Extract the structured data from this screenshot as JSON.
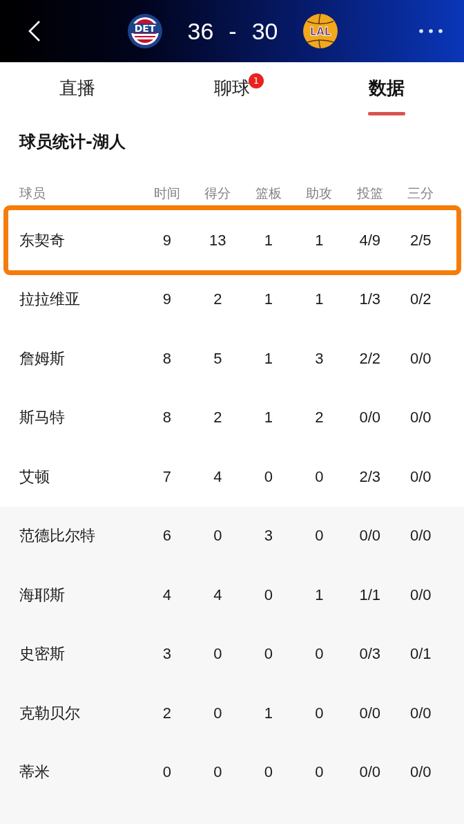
{
  "header": {
    "home_team": {
      "abbr": "DET"
    },
    "home_score": "36",
    "separator": "-",
    "away_score": "30",
    "away_team": {
      "abbr": "LAL"
    }
  },
  "tabs": [
    {
      "label": "直播",
      "selected": false
    },
    {
      "label": "聊球",
      "selected": false,
      "badge": "1"
    },
    {
      "label": "数据",
      "selected": true
    }
  ],
  "table": {
    "title": "球员统计-湖人",
    "columns": [
      "球员",
      "时间",
      "得分",
      "篮板",
      "助攻",
      "投篮",
      "三分"
    ],
    "groups": [
      {
        "kind": "starters",
        "rows": [
          {
            "player": "东契奇",
            "stats": [
              "9",
              "13",
              "1",
              "1",
              "4/9",
              "2/5"
            ],
            "highlighted": true
          },
          {
            "player": "拉拉维亚",
            "stats": [
              "9",
              "2",
              "1",
              "1",
              "1/3",
              "0/2"
            ],
            "highlighted": false
          },
          {
            "player": "詹姆斯",
            "stats": [
              "8",
              "5",
              "1",
              "3",
              "2/2",
              "0/0"
            ],
            "highlighted": false
          },
          {
            "player": "斯马特",
            "stats": [
              "8",
              "2",
              "1",
              "2",
              "0/0",
              "0/0"
            ],
            "highlighted": false
          },
          {
            "player": "艾顿",
            "stats": [
              "7",
              "4",
              "0",
              "0",
              "2/3",
              "0/0"
            ],
            "highlighted": false
          }
        ]
      },
      {
        "kind": "bench",
        "rows": [
          {
            "player": "范德比尔特",
            "stats": [
              "6",
              "0",
              "3",
              "0",
              "0/0",
              "0/0"
            ],
            "highlighted": false
          },
          {
            "player": "海耶斯",
            "stats": [
              "4",
              "4",
              "0",
              "1",
              "1/1",
              "0/0"
            ],
            "highlighted": false
          },
          {
            "player": "史密斯",
            "stats": [
              "3",
              "0",
              "0",
              "0",
              "0/3",
              "0/1"
            ],
            "highlighted": false
          },
          {
            "player": "克勒贝尔",
            "stats": [
              "2",
              "0",
              "1",
              "0",
              "0/0",
              "0/0"
            ],
            "highlighted": false
          },
          {
            "player": "蒂米",
            "stats": [
              "0",
              "0",
              "0",
              "0",
              "0/0",
              "0/0"
            ],
            "highlighted": false
          }
        ]
      }
    ]
  }
}
